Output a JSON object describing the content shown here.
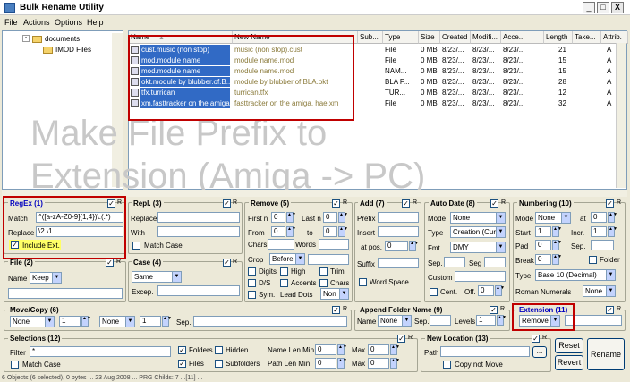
{
  "app": {
    "title": "Bulk Rename Utility",
    "min": "_",
    "max": "□",
    "close": "X"
  },
  "menu": [
    "File",
    "Actions",
    "Options",
    "Help"
  ],
  "tree": {
    "items": [
      {
        "label": "documents",
        "sign": "-"
      },
      {
        "label": "IMOD Files",
        "sign": ""
      }
    ]
  },
  "list": {
    "columns": [
      "Name",
      "New Name",
      "Sub...",
      "Type",
      "Size",
      "Created",
      "Modifi...",
      "Acce...",
      "Length",
      "Take...",
      "Attrib."
    ],
    "rows": [
      {
        "name": "cust.music (non stop)",
        "new": "music (non stop).cust",
        "type": "File",
        "size": "0 MB",
        "created": "8/23/...",
        "modified": "8/23/...",
        "accessed": "8/23/...",
        "length": "21",
        "attr": "A"
      },
      {
        "name": "mod.module name",
        "new": "module name.mod",
        "type": "File",
        "size": "0 MB",
        "created": "8/23/...",
        "modified": "8/23/...",
        "accessed": "8/23/...",
        "length": "15",
        "attr": "A"
      },
      {
        "name": "mod.module name",
        "new": "module name.mod",
        "type": "NAM...",
        "size": "0 MB",
        "created": "8/23/...",
        "modified": "8/23/...",
        "accessed": "8/23/...",
        "length": "15",
        "attr": "A"
      },
      {
        "name": "okt.module by blubber.of.B...",
        "new": "module by blubber.of.BLA.okt",
        "type": "BLA F...",
        "size": "0 MB",
        "created": "8/23/...",
        "modified": "8/23/...",
        "accessed": "8/23/...",
        "length": "28",
        "attr": "A"
      },
      {
        "name": "tfx.turrican",
        "new": "turrican.tfx",
        "type": "TUR...",
        "size": "0 MB",
        "created": "8/23/...",
        "modified": "8/23/...",
        "accessed": "8/23/...",
        "length": "12",
        "attr": "A"
      },
      {
        "name": "xm.fasttracker on the amiga...",
        "new": "fasttracker on the amiga. hae.xm",
        "type": "File",
        "size": "0 MB",
        "created": "8/23/...",
        "modified": "8/23/...",
        "accessed": "8/23/...",
        "length": "32",
        "attr": "A"
      }
    ]
  },
  "watermark": {
    "line1": "Make File Prefix to",
    "line2": "Extension (Amiga -> PC)"
  },
  "regex": {
    "title": "RegEx (1)",
    "match_label": "Match",
    "match_value": "^([a-zA-Z0-9]{1,4})\\.(.*)",
    "replace_label": "Replace",
    "replace_value": "\\2.\\1",
    "include_ext": "Include Ext.",
    "r": "R"
  },
  "repl": {
    "title": "Repl. (3)",
    "replace": "Replace",
    "with": "With",
    "match_case": "Match Case",
    "r": "R"
  },
  "remove": {
    "title": "Remove (5)",
    "first_n": "First n",
    "last_n": "Last n",
    "from": "From",
    "to": "to",
    "chars": "Chars",
    "words": "Words",
    "crop": "Crop",
    "crop_value": "Before",
    "digits": "Digits",
    "high": "High",
    "trim": "Trim",
    "ds": "D/S",
    "accents": "Accents",
    "chars2": "Chars",
    "sym": "Sym.",
    "lead_dots": "Lead Dots",
    "lead_value": "Non",
    "first_n_val": "0",
    "last_n_val": "0",
    "from_val": "0",
    "to_val": "0",
    "r": "R"
  },
  "add": {
    "title": "Add (7)",
    "prefix": "Prefix",
    "insert": "Insert",
    "at_pos": "at pos.",
    "at_pos_val": "0",
    "suffix": "Suffix",
    "word_space": "Word Space",
    "r": "R"
  },
  "autodate": {
    "title": "Auto Date (8)",
    "mode": "Mode",
    "mode_val": "None",
    "type": "Type",
    "type_val": "Creation (Cur",
    "fmt": "Fmt",
    "fmt_val": "DMY",
    "sep": "Sep.",
    "seg": "Seg",
    "custom": "Custom",
    "cent": "Cent.",
    "off": "Off.",
    "off_val": "0",
    "r": "R"
  },
  "numbering": {
    "title": "Numbering (10)",
    "mode": "Mode",
    "mode_val": "None",
    "at": "at",
    "at_val": "0",
    "start": "Start",
    "start_val": "1",
    "incr": "Incr.",
    "incr_val": "1",
    "pad": "Pad",
    "pad_val": "0",
    "sep": "Sep.",
    "break": "Break",
    "break_val": "0",
    "folder": "Folder",
    "type": "Type",
    "type_val": "Base 10 (Decimal)",
    "roman": "Roman Numerals",
    "roman_val": "None",
    "r": "R"
  },
  "file": {
    "title": "File (2)",
    "name": "Name",
    "name_val": "Keep",
    "r": "R"
  },
  "case": {
    "title": "Case (4)",
    "case_val": "Same",
    "excep": "Excep.",
    "r": "R"
  },
  "movecopy": {
    "title": "Move/Copy (6)",
    "sel1": "None",
    "n1": "1",
    "sel2": "None",
    "n2": "1",
    "sep": "Sep.",
    "r": "R"
  },
  "append": {
    "title": "Append Folder Name (9)",
    "name": "Name",
    "name_val": "None",
    "sep": "Sep.",
    "levels": "Levels",
    "levels_val": "1",
    "r": "R"
  },
  "extension": {
    "title": "Extension (11)",
    "val": "Remove",
    "r": "R"
  },
  "selections": {
    "title": "Selections (12)",
    "filter": "Filter",
    "filter_val": "*",
    "folders": "Folders",
    "hidden": "Hidden",
    "name_len_min": "Name Len Min",
    "nlmin": "0",
    "max": "Max",
    "nlmax": "0",
    "match_case": "Match Case",
    "files": "Files",
    "subfolders": "Subfolders",
    "path_len_min": "Path Len Min",
    "plmin": "0",
    "max2": "Max",
    "plmax": "0",
    "r": "R"
  },
  "newloc": {
    "title": "New Location (13)",
    "path": "Path",
    "copy_not_move": "Copy not Move",
    "browse": "...",
    "r": "R"
  },
  "buttons": {
    "reset": "Reset",
    "revert": "Revert",
    "rename": "Rename"
  },
  "status": "6 Objects (6 selected), 0 bytes ... 23 Aug 2008 ... PRG Childs: 7 ...[11] ..."
}
